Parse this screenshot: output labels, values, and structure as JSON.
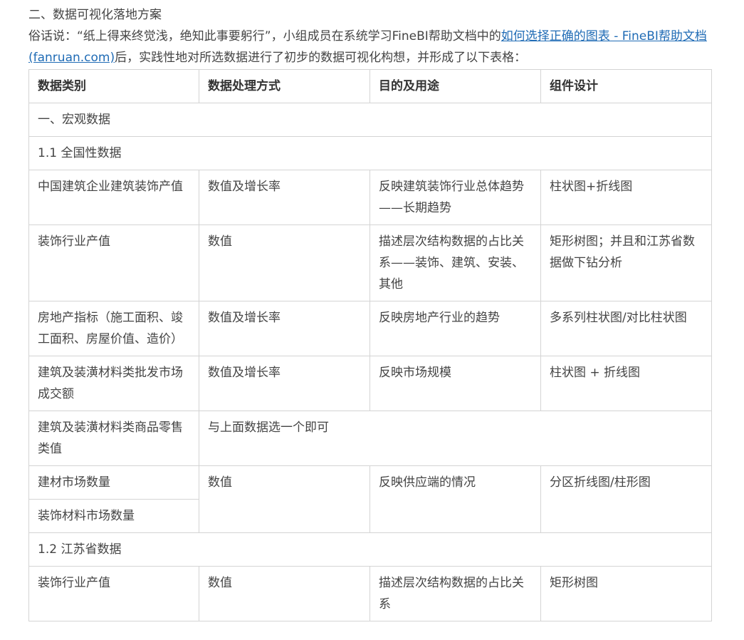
{
  "heading": "二、数据可视化落地方案",
  "intro": {
    "before": "俗话说：“纸上得来终觉浅，绝知此事要躬行”，小组成员在系统学习FineBI帮助文档中的",
    "link": "如何选择正确的图表 - FineBI帮助文档 (fanruan.com)",
    "after": "后，实践性地对所选数据进行了初步的数据可视化构想，并形成了以下表格："
  },
  "colors": {
    "link": "#1f6bb5",
    "text": "#444444",
    "border": "#d4d4d4"
  },
  "table": {
    "headers": [
      "数据类别",
      "数据处理方式",
      "目的及用途",
      "组件设计"
    ],
    "section_macro": "一、宏观数据",
    "section_national": "1.1 全国性数据",
    "rows": [
      [
        "中国建筑企业建筑装饰产值",
        "数值及增长率",
        "反映建筑装饰行业总体趋势——长期趋势",
        "柱状图+折线图"
      ],
      [
        "装饰行业产值",
        "数值",
        "描述层次结构数据的占比关系——装饰、建筑、安装、其他",
        "矩形树图；并且和江苏省数据做下钻分析"
      ],
      [
        "房地产指标（施工面积、竣工面积、房屋价值、造价）",
        "数值及增长率",
        "反映房地产行业的趋势",
        "多系列柱状图/对比柱状图"
      ],
      [
        "建筑及装潢材料类批发市场成交额",
        "数值及增长率",
        "反映市场规模",
        "柱状图 + 折线图"
      ]
    ],
    "retail_row": {
      "category": "建筑及装潢材料类商品零售类值",
      "note": "与上面数据选一个即可"
    },
    "market_rows": {
      "category_a": "建材市场数量",
      "category_b": "装饰材料市场数量",
      "method": "数值",
      "purpose": "反映供应端的情况",
      "design": "分区折线图/柱形图"
    },
    "section_jiangsu": "1.2 江苏省数据",
    "jiangsu_rows": [
      [
        "装饰行业产值",
        "数值",
        "描述层次结构数据的占比关系",
        "矩形树图"
      ]
    ]
  }
}
